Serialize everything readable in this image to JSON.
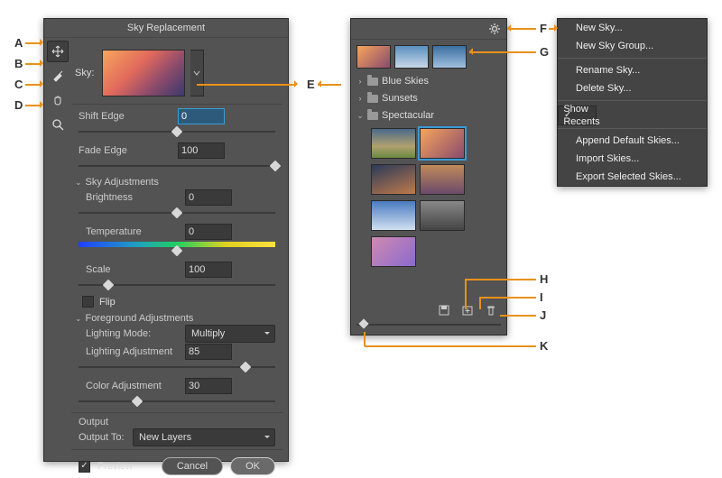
{
  "dialog": {
    "title": "Sky Replacement",
    "tools": [
      "move-tool",
      "brush-tool",
      "hand-tool",
      "zoom-tool"
    ],
    "sky_label": "Sky:",
    "shift_edge": {
      "label": "Shift Edge",
      "value": "0",
      "pos": 50
    },
    "fade_edge": {
      "label": "Fade Edge",
      "value": "100",
      "pos": 100
    },
    "sky_adj_header": "Sky Adjustments",
    "brightness": {
      "label": "Brightness",
      "value": "0",
      "pos": 50
    },
    "temperature": {
      "label": "Temperature",
      "value": "0",
      "pos": 50
    },
    "scale": {
      "label": "Scale",
      "value": "100",
      "pos": 15
    },
    "flip_label": "Flip",
    "fg_adj_header": "Foreground Adjustments",
    "lighting_mode": {
      "label": "Lighting Mode:",
      "value": "Multiply"
    },
    "lighting_adj": {
      "label": "Lighting Adjustment",
      "value": "85",
      "pos": 85
    },
    "color_adj": {
      "label": "Color Adjustment",
      "value": "30",
      "pos": 30
    },
    "output_header": "Output",
    "output_to": {
      "label": "Output To:",
      "value": "New Layers"
    },
    "preview_label": "Preview",
    "cancel": "Cancel",
    "ok": "OK"
  },
  "presets": {
    "folders": [
      {
        "name": "Blue Skies",
        "open": false
      },
      {
        "name": "Sunsets",
        "open": false
      },
      {
        "name": "Spectacular",
        "open": true
      }
    ],
    "recent_count": 3,
    "spectacular_count": 7,
    "selected_index": 1,
    "thumb_colors": {
      "recent": [
        "linear-gradient(135deg,#f6a55c,#8a4a6c)",
        "linear-gradient(180deg,#5a8fbf,#c8d8e8)",
        "linear-gradient(180deg,#3a6fa0,#a0c0e0)"
      ],
      "grid": [
        "linear-gradient(180deg,#4a6a8a 0%,#b0a070 60%,#6a8a40 100%)",
        "linear-gradient(135deg,#f6a55c,#8a4a6c)",
        "linear-gradient(160deg,#2a3a5a,#c07a4a)",
        "linear-gradient(180deg,#c08a5a,#6a4a6a)",
        "linear-gradient(180deg,#4a7ac0,#d0e0f0)",
        "linear-gradient(180deg,#888,#444)",
        "linear-gradient(135deg,#d08ab0,#8a6ad0)"
      ]
    }
  },
  "menu": {
    "items": [
      {
        "label": "New Sky...",
        "sep_after": false
      },
      {
        "label": "New Sky Group...",
        "sep_after": true
      },
      {
        "label": "Rename Sky...",
        "sep_after": false
      },
      {
        "label": "Delete Sky...",
        "sep_after": true
      },
      {
        "label": "Show Recents",
        "checked": true,
        "sep_after": true
      },
      {
        "label": "Append Default Skies...",
        "sep_after": false
      },
      {
        "label": "Import Skies...",
        "sep_after": false
      },
      {
        "label": "Export Selected Skies...",
        "sep_after": false
      }
    ]
  },
  "callouts": {
    "A": "A",
    "B": "B",
    "C": "C",
    "D": "D",
    "E": "E",
    "F": "F",
    "G": "G",
    "H": "H",
    "I": "I",
    "J": "J",
    "K": "K"
  }
}
